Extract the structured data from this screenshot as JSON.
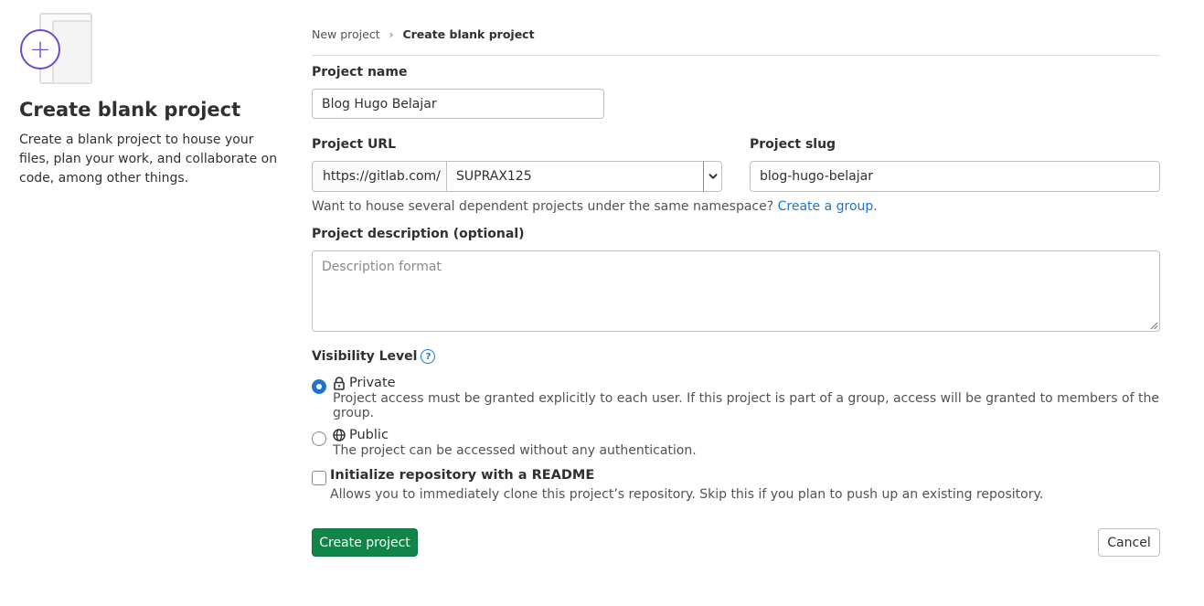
{
  "sidebar": {
    "illustration_icon": "plus-circle-icon",
    "title": "Create blank project",
    "description": "Create a blank project to house your files, plan your work, and collaborate on code, among other things."
  },
  "breadcrumb": {
    "parent": "New project",
    "current": "Create blank project"
  },
  "form": {
    "project_name": {
      "label": "Project name",
      "value": "Blog Hugo Belajar"
    },
    "project_url": {
      "label": "Project URL",
      "prefix": "https://gitlab.com/",
      "namespace": "SUPRAX125"
    },
    "project_slug": {
      "label": "Project slug",
      "value": "blog-hugo-belajar"
    },
    "group_help": {
      "text": "Want to house several dependent projects under the same namespace?",
      "link": "Create a group."
    },
    "description": {
      "label": "Project description (optional)",
      "placeholder": "Description format"
    },
    "visibility": {
      "label": "Visibility Level",
      "options": [
        {
          "label": "Private",
          "description": "Project access must be granted explicitly to each user. If this project is part of a group, access will be granted to members of the group.",
          "icon": "lock-icon",
          "checked": true
        },
        {
          "label": "Public",
          "description": "The project can be accessed without any authentication.",
          "icon": "globe-icon",
          "checked": false
        }
      ]
    },
    "readme": {
      "label": "Initialize repository with a README",
      "description": "Allows you to immediately clone this project’s repository. Skip this if you plan to push up an existing repository.",
      "checked": false
    }
  },
  "actions": {
    "create": "Create project",
    "cancel": "Cancel"
  },
  "colors": {
    "primary_button": "#108548",
    "link": "#1f75cb",
    "accent_purple": "#6e49cb"
  }
}
